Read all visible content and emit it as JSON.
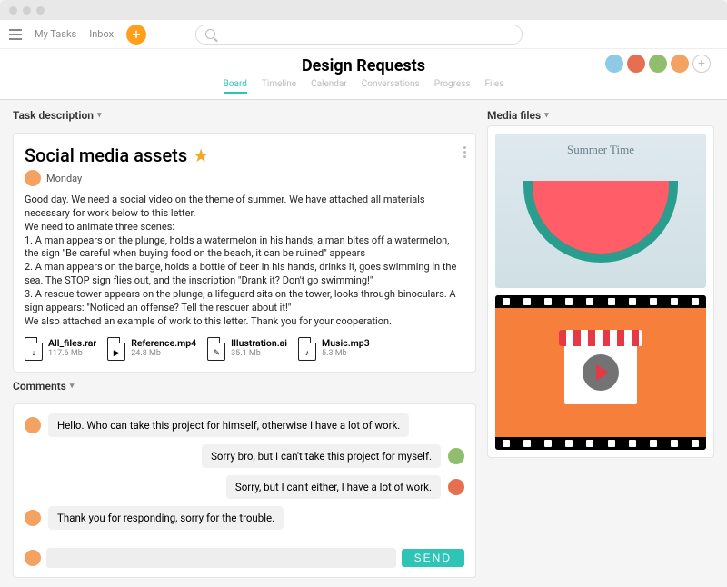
{
  "nav": {
    "myTasks": "My Tasks",
    "inbox": "Inbox"
  },
  "header": {
    "title": "Design Requests",
    "tabs": [
      "Board",
      "Timeline",
      "Calendar",
      "Conversations",
      "Progress",
      "Files"
    ],
    "activeTab": "Board"
  },
  "sections": {
    "taskDescription": "Task description",
    "comments": "Comments",
    "mediaFiles": "Media files"
  },
  "task": {
    "title": "Social media assets",
    "starred": true,
    "byline": "Monday",
    "body": "Good day. We need a social video on the theme of summer. We have attached all materials necessary for work below to this letter.\nWe need to animate three scenes:\n1. A man appears on the plunge, holds a watermelon in his hands, a man bites off a watermelon, the sign \"Be careful when buying food on the beach, it can be ruined\" appears\n2. A man appears on the barge, holds a bottle of beer in his hands, drinks it, goes swimming in the sea. The STOP sign flies out, and the inscription \"Drank it? Don't go swimming!\"\n3. A rescue tower appears on the plunge, a lifeguard sits on the tower, looks through binoculars. A sign appears: \"Noticed an offense? Tell the rescuer about it!\"\nWe also attached an example of work to this letter. Thank you for your cooperation.",
    "files": [
      {
        "name": "All_files.rar",
        "size": "117.6 Mb",
        "glyph": "↓"
      },
      {
        "name": "Reference.mp4",
        "size": "24.8 Mb",
        "glyph": "▶"
      },
      {
        "name": "Illustration.ai",
        "size": "35.1 Mb",
        "glyph": "✎"
      },
      {
        "name": "Music.mp3",
        "size": "5.3 Mb",
        "glyph": "♪"
      }
    ]
  },
  "comments": [
    {
      "side": "left",
      "text": "Hello. Who can take this project for himself, otherwise I have a lot of work.",
      "avatar": "a1"
    },
    {
      "side": "right",
      "text": "Sorry bro, but I can't take this project for myself.",
      "avatar": "a4"
    },
    {
      "side": "right",
      "text": "Sorry, but I can't either, I have a lot of work.",
      "avatar": "a3"
    },
    {
      "side": "left",
      "text": "Thank you for responding, sorry for the trouble.",
      "avatar": "a1"
    }
  ],
  "composer": {
    "placeholder": "",
    "send": "SEND"
  },
  "media": {
    "summerCaption": "Summer Time"
  }
}
